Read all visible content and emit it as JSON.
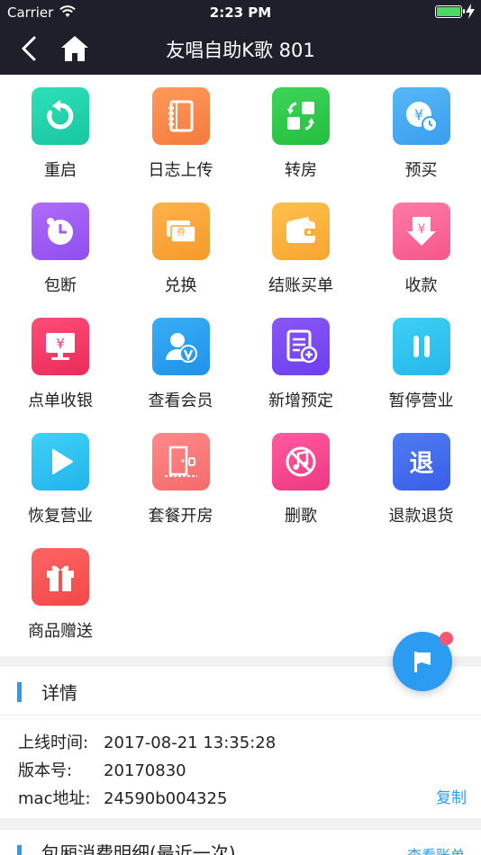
{
  "status": {
    "carrier": "Carrier",
    "time": "2:23 PM"
  },
  "nav": {
    "title": "友唱自助K歌 801"
  },
  "grid": [
    {
      "label": "重启",
      "icon": "restart-icon",
      "c1": "#2de0b8",
      "c2": "#19c6a0"
    },
    {
      "label": "日志上传",
      "icon": "notebook-icon",
      "c1": "#ff9a5c",
      "c2": "#f47a3c"
    },
    {
      "label": "转房",
      "icon": "room-transfer-icon",
      "c1": "#3fd45c",
      "c2": "#24bf3e"
    },
    {
      "label": "预买",
      "icon": "prepay-icon",
      "c1": "#56b8f5",
      "c2": "#3a9ef0"
    },
    {
      "label": "包断",
      "icon": "clock-icon",
      "c1": "#b06bf7",
      "c2": "#8f4ef0"
    },
    {
      "label": "兑换",
      "icon": "voucher-icon",
      "c1": "#ffb24a",
      "c2": "#f59a2a"
    },
    {
      "label": "结账买单",
      "icon": "wallet-icon",
      "c1": "#ffc04d",
      "c2": "#f7a52f"
    },
    {
      "label": "收款",
      "icon": "receive-money-icon",
      "c1": "#ff7aa8",
      "c2": "#f5578a"
    },
    {
      "label": "点单收银",
      "icon": "cashier-monitor-icon",
      "c1": "#ff4d78",
      "c2": "#ec2a5a"
    },
    {
      "label": "查看会员",
      "icon": "vip-member-icon",
      "c1": "#38aef5",
      "c2": "#1f92ea"
    },
    {
      "label": "新增预定",
      "icon": "add-reservation-icon",
      "c1": "#8a58f5",
      "c2": "#6c3ef0"
    },
    {
      "label": "暂停营业",
      "icon": "pause-icon",
      "c1": "#3fd0f5",
      "c2": "#25b7ea"
    },
    {
      "label": "恢复营业",
      "icon": "play-icon",
      "c1": "#40d0f7",
      "c2": "#22b4ec"
    },
    {
      "label": "套餐开房",
      "icon": "door-icon",
      "c1": "#ff8a8a",
      "c2": "#f56a6a"
    },
    {
      "label": "删歌",
      "icon": "delete-song-icon",
      "c1": "#ff5aa0",
      "c2": "#ee3882"
    },
    {
      "label": "退款退货",
      "icon": "refund-icon",
      "c1": "#4f7bf2",
      "c2": "#3a5ee8"
    },
    {
      "label": "商品赠送",
      "icon": "gift-icon",
      "c1": "#ff6464",
      "c2": "#f24848"
    }
  ],
  "detail": {
    "title": "详情",
    "online_key": "上线时间:",
    "online_val": "2017-08-21 13:35:28",
    "version_key": "版本号:",
    "version_val": "20170830",
    "mac_key": "mac地址:",
    "mac_val": "24590b004325",
    "copy": "复制"
  },
  "bill": {
    "title": "包厢消费明细(最近一次)",
    "link": "查看账单"
  },
  "colors": {
    "accent": "#2b9cf2",
    "nav_bg": "#1e1f2b",
    "badge": "#f45674"
  }
}
